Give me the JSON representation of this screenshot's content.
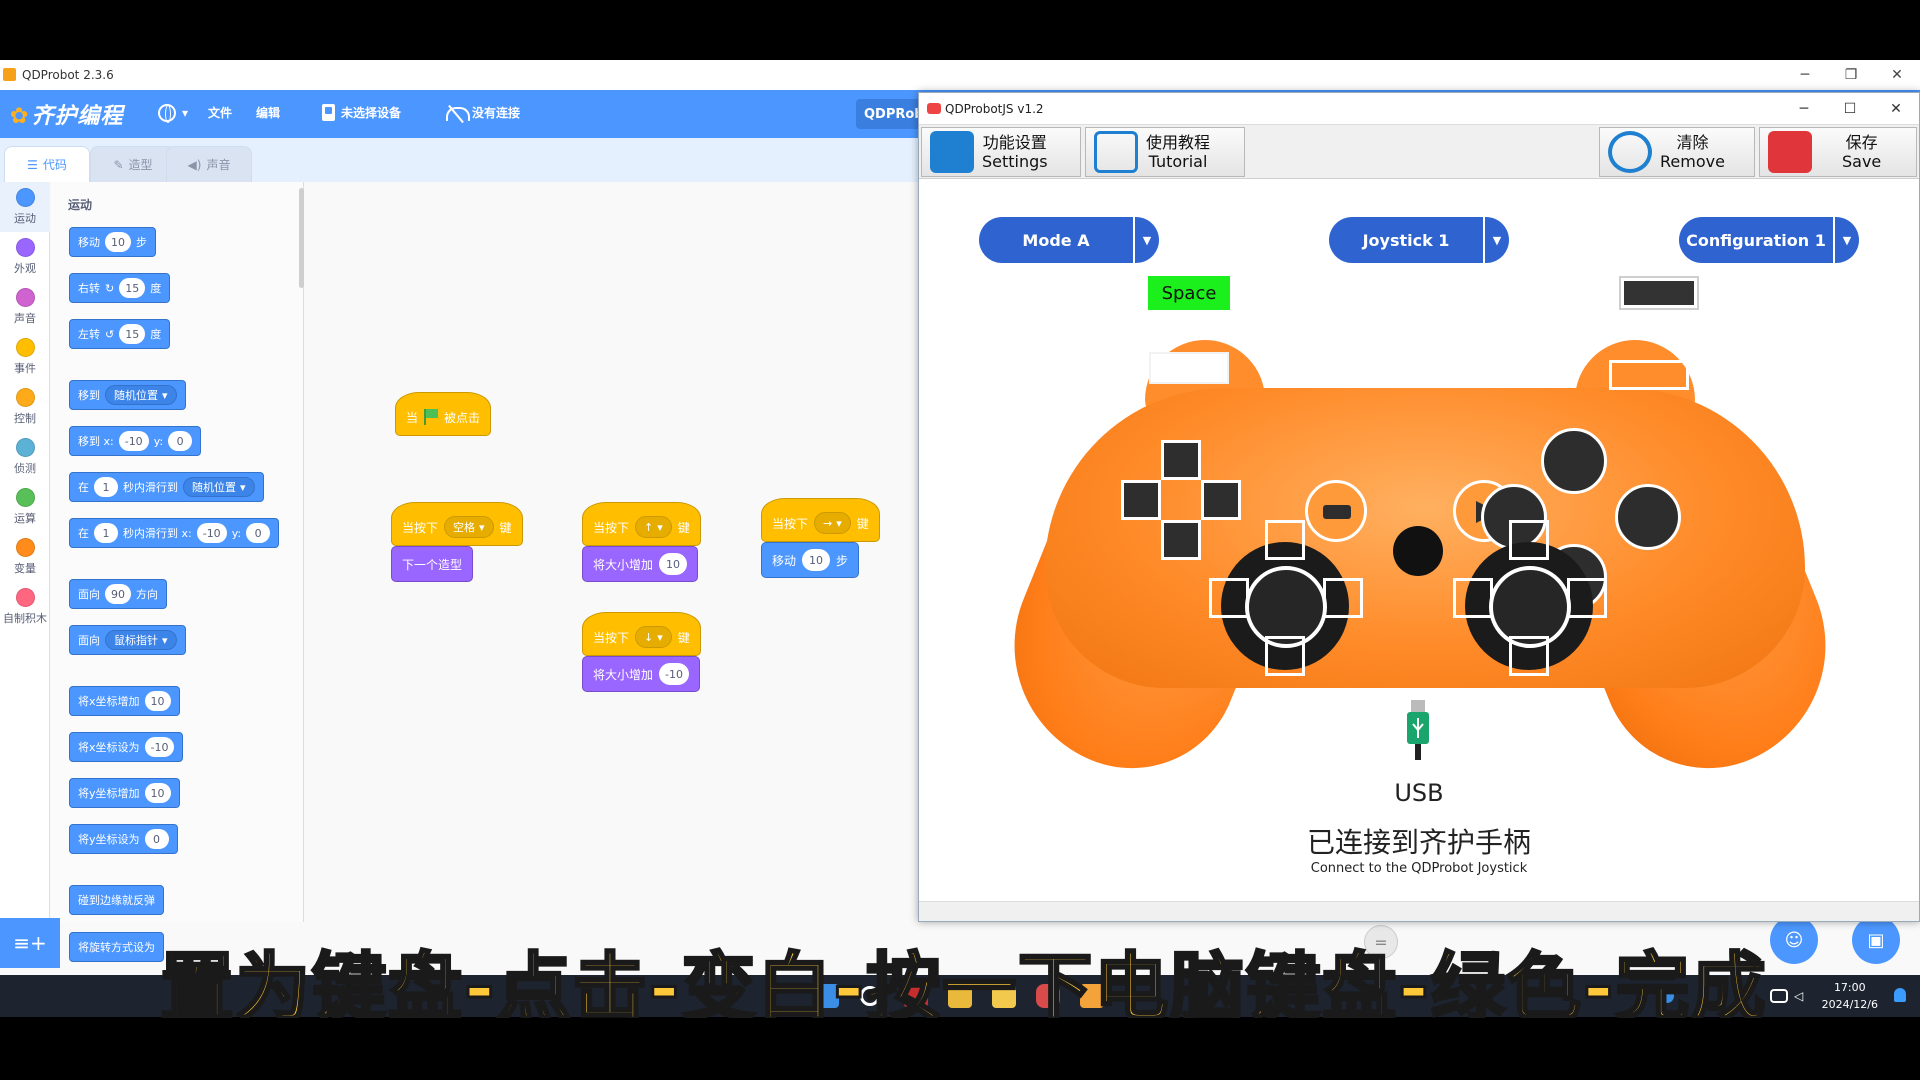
{
  "scratch": {
    "title": "QDProbot 2.3.6",
    "brand": "齐护编程",
    "menu": {
      "file": "文件",
      "edit": "编辑",
      "device": "未选择设备",
      "connection": "没有连接",
      "qdp": "QDPRob"
    },
    "tabs": [
      "代码",
      "造型",
      "声音"
    ],
    "categories": [
      {
        "label": "运动",
        "color": "#4c97ff"
      },
      {
        "label": "外观",
        "color": "#9966ff"
      },
      {
        "label": "声音",
        "color": "#cf63cf"
      },
      {
        "label": "事件",
        "color": "#ffbf00"
      },
      {
        "label": "控制",
        "color": "#ffab19"
      },
      {
        "label": "侦测",
        "color": "#5cb1d6"
      },
      {
        "label": "运算",
        "color": "#59c059"
      },
      {
        "label": "变量",
        "color": "#ff8c1a"
      },
      {
        "label": "自制积木",
        "color": "#ff6680"
      }
    ],
    "palette": {
      "heading": "运动",
      "blocks": {
        "move": {
          "a": "移动",
          "n": "10",
          "b": "步"
        },
        "turn_right": {
          "a": "右转",
          "n": "15",
          "b": "度"
        },
        "turn_left": {
          "a": "左转",
          "n": "15",
          "b": "度"
        },
        "goto": {
          "a": "移到",
          "d": "随机位置"
        },
        "goto_xy": {
          "a": "移到 x:",
          "x": "-10",
          "y_label": "y:",
          "y": "0"
        },
        "glide": {
          "a": "在",
          "n": "1",
          "b": "秒内滑行到",
          "d": "随机位置"
        },
        "glide_xy": {
          "a": "在",
          "n": "1",
          "b": "秒内滑行到 x:",
          "x": "-10",
          "y_label": "y:",
          "y": "0"
        },
        "point_dir": {
          "a": "面向",
          "n": "90",
          "b": "方向"
        },
        "point_towards": {
          "a": "面向",
          "d": "鼠标指针"
        },
        "change_x": {
          "a": "将x坐标增加",
          "n": "10"
        },
        "set_x": {
          "a": "将x坐标设为",
          "n": "-10"
        },
        "change_y": {
          "a": "将y坐标增加",
          "n": "10"
        },
        "set_y": {
          "a": "将y坐标设为",
          "n": "0"
        },
        "bounce": {
          "a": "碰到边缘就反弹"
        },
        "rotation": {
          "a": "将旋转方式设为"
        }
      }
    },
    "scripts": {
      "flag_hat": {
        "a": "当",
        "b": "被点击"
      },
      "space_hat": {
        "a": "当按下",
        "d": "空格",
        "b": "键"
      },
      "next_costume": "下一个造型",
      "up_hat": {
        "a": "当按下",
        "d": "↑",
        "b": "键"
      },
      "grow": {
        "a": "将大小增加",
        "n": "10"
      },
      "down_hat": {
        "a": "当按下",
        "d": "↓",
        "b": "键"
      },
      "shrink": {
        "a": "将大小增加",
        "n": "-10"
      },
      "right_hat": {
        "a": "当按下",
        "d": "→",
        "b": "键"
      },
      "move10": {
        "a": "移动",
        "n": "10",
        "b": "步"
      }
    }
  },
  "joystick": {
    "title": "QDProbotJS v1.2",
    "toolbar": {
      "settings": {
        "cn": "功能设置",
        "en": "Settings"
      },
      "tutorial": {
        "cn": "使用教程",
        "en": "Tutorial"
      },
      "remove": {
        "cn": "清除",
        "en": "Remove"
      },
      "save": {
        "cn": "保存",
        "en": "Save"
      }
    },
    "mode": "Mode A",
    "stick": "Joystick 1",
    "config": "Configuration 1",
    "key_label": "Space",
    "usb": "USB",
    "connected_cn": "已连接到齐护手柄",
    "connected_en": "Connect to the QDProbot Joystick",
    "colors": {
      "pad_orange": "#ff8a28",
      "button_blue": "#2f64d0",
      "active_key": "#1cf01c"
    }
  },
  "subtitle": "置为键盘-点击-变白-按一下电脑键盘-绿色-完成",
  "taskbar": {
    "time": "17:00",
    "date": "2024/12/6"
  }
}
